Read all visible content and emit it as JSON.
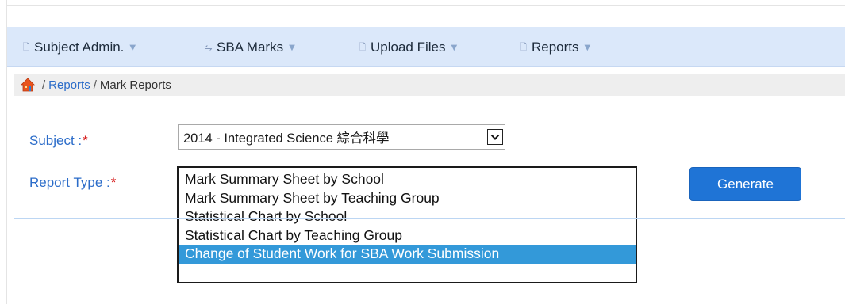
{
  "nav": {
    "items": [
      {
        "label": "Subject Admin.",
        "icon": "document-icon"
      },
      {
        "label": "SBA Marks",
        "icon": "swap-icon"
      },
      {
        "label": "Upload Files",
        "icon": "document-icon"
      },
      {
        "label": "Reports",
        "icon": "document-icon"
      }
    ]
  },
  "breadcrumb": {
    "sep": "/",
    "reports": "Reports",
    "current": "Mark Reports"
  },
  "form": {
    "subject_label": "Subject :",
    "report_type_label": "Report Type :",
    "required_mark": "*",
    "subject_value": "2014 - Integrated Science 綜合科學",
    "report_options": [
      "Mark Summary Sheet by School",
      "Mark Summary Sheet by Teaching Group",
      "Statistical Chart by School",
      "Statistical Chart by Teaching Group",
      "Change of Student Work for SBA Work Submission"
    ],
    "selected_index": 4,
    "generate_label": "Generate"
  },
  "colors": {
    "nav_bg": "#dbe8fa",
    "link": "#2b6cc9",
    "required": "#d61a1a",
    "button": "#1f74d6",
    "selected_option": "#3399d9"
  }
}
